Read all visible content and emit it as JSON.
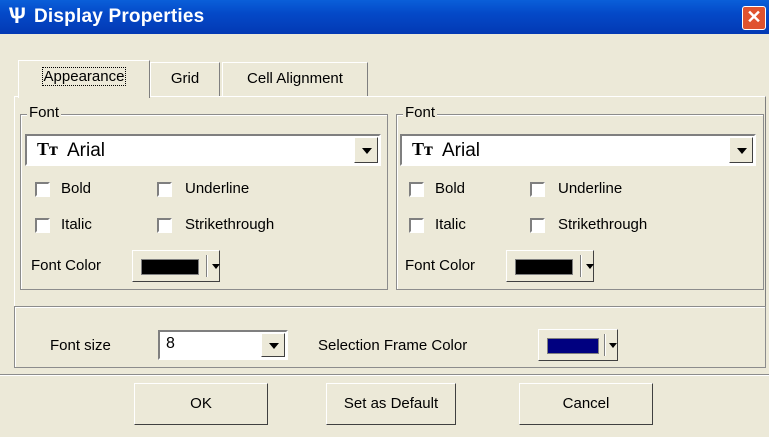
{
  "window": {
    "title": "Display Properties",
    "title_icon": "Ѱ",
    "close_glyph": "✕"
  },
  "tabs": [
    {
      "label": "Appearance",
      "active": true
    },
    {
      "label": "Grid",
      "active": false
    },
    {
      "label": "Cell Alignment",
      "active": false
    }
  ],
  "left_font": {
    "legend": "Font",
    "font_icon": "Tт",
    "font_value": "Arial",
    "bold_label": "Bold",
    "underline_label": "Underline",
    "italic_label": "Italic",
    "strike_label": "Strikethrough",
    "bold_checked": false,
    "underline_checked": false,
    "italic_checked": false,
    "strike_checked": false,
    "color_label": "Font Color",
    "color_value": "#000000"
  },
  "right_font": {
    "legend": "Font",
    "font_icon": "Tт",
    "font_value": "Arial",
    "bold_label": "Bold",
    "underline_label": "Underline",
    "italic_label": "Italic",
    "strike_label": "Strikethrough",
    "bold_checked": false,
    "underline_checked": false,
    "italic_checked": false,
    "strike_checked": false,
    "color_label": "Font Color",
    "color_value": "#000000"
  },
  "settings": {
    "font_size_label": "Font size",
    "font_size_value": "8",
    "frame_color_label": "Selection Frame Color",
    "frame_color_value": "#000080"
  },
  "buttons": {
    "ok": "OK",
    "set_default": "Set as Default",
    "cancel": "Cancel"
  },
  "colors": {
    "title_bar": "#0449c8",
    "close_button": "#e0532f",
    "dialog_bg": "#ece9d8"
  }
}
